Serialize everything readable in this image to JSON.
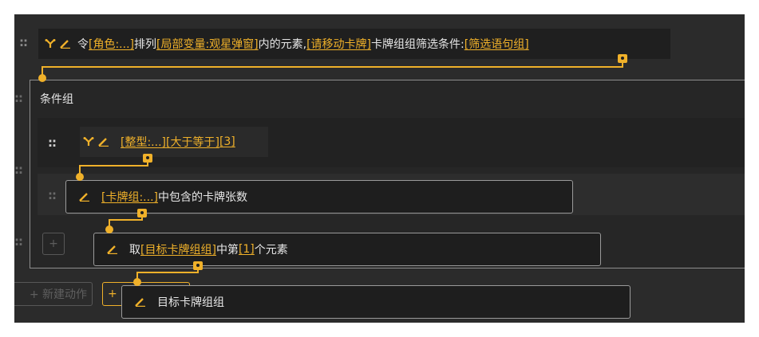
{
  "top_action": {
    "prefix": "令",
    "role": "[角色:...]",
    "t1": "排列",
    "var": "[局部变量:观星弹窗]",
    "t2": "内的元素,",
    "move": "[请移动卡牌]",
    "t3": "卡牌组组筛选条件:",
    "filter": "[筛选语句组]"
  },
  "condition_group": {
    "title": "条件组"
  },
  "int_row": {
    "type_link": "[整型:...]",
    "op_link": "[大于等于]",
    "val_link": "[3]"
  },
  "count_row": {
    "cards_link": "[卡牌组:...]",
    "text": "中包含的卡牌张数"
  },
  "take_row": {
    "prefix": "取",
    "group_link": "[目标卡牌组组]",
    "mid": "中第",
    "idx_link": "[1]",
    "suffix": "个元素"
  },
  "target_row": {
    "text": "目标卡牌组组"
  },
  "new_action": {
    "label": "+ 新建动作"
  },
  "drag_glyph": "::",
  "plus_glyph": "+",
  "colors": {
    "accent": "#f0b12a",
    "panel": "#2b2b2b",
    "border": "#9a9a9a"
  },
  "icons": [
    "branch-icon",
    "pencil-icon",
    "drag-handle-icon",
    "connector-node-icon"
  ]
}
